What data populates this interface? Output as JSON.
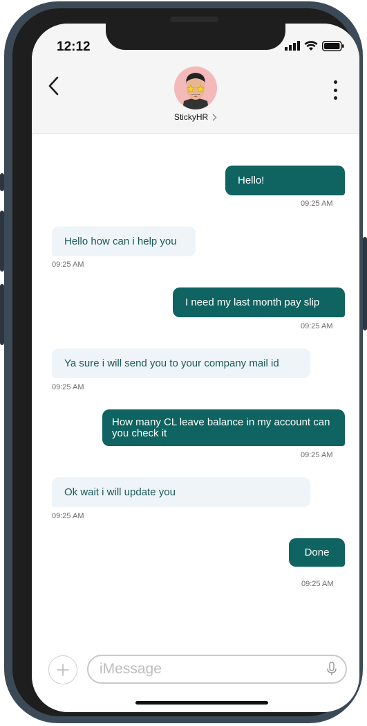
{
  "status_bar": {
    "time": "12:12"
  },
  "header": {
    "contact_name": "StickyHR"
  },
  "messages": [
    {
      "direction": "out",
      "text": "Hello!",
      "time": "09:25 AM"
    },
    {
      "direction": "in",
      "text": "Hello how can i help you",
      "time": "09:25 AM"
    },
    {
      "direction": "out",
      "text": "I need my last month pay slip",
      "time": "09:25 AM"
    },
    {
      "direction": "in",
      "text": "Ya sure i will send you to your company mail id",
      "time": "09:25 AM"
    },
    {
      "direction": "out",
      "text": "How many CL leave balance in my account can you check it",
      "time": "09:25 AM"
    },
    {
      "direction": "in",
      "text": "Ok wait i will update you",
      "time": "09:25 AM"
    },
    {
      "direction": "out",
      "text": "Done",
      "time": "09:25 AM"
    }
  ],
  "composer": {
    "placeholder": "iMessage"
  },
  "colors": {
    "outgoing_bubble": "#0f6361",
    "incoming_bubble": "#eef4f8",
    "incoming_text": "#1a5a5a"
  },
  "icons": [
    "back-chevron-icon",
    "more-vertical-icon",
    "signal-icon",
    "wifi-icon",
    "battery-icon",
    "plus-icon",
    "microphone-icon",
    "contact-chevron-icon"
  ]
}
